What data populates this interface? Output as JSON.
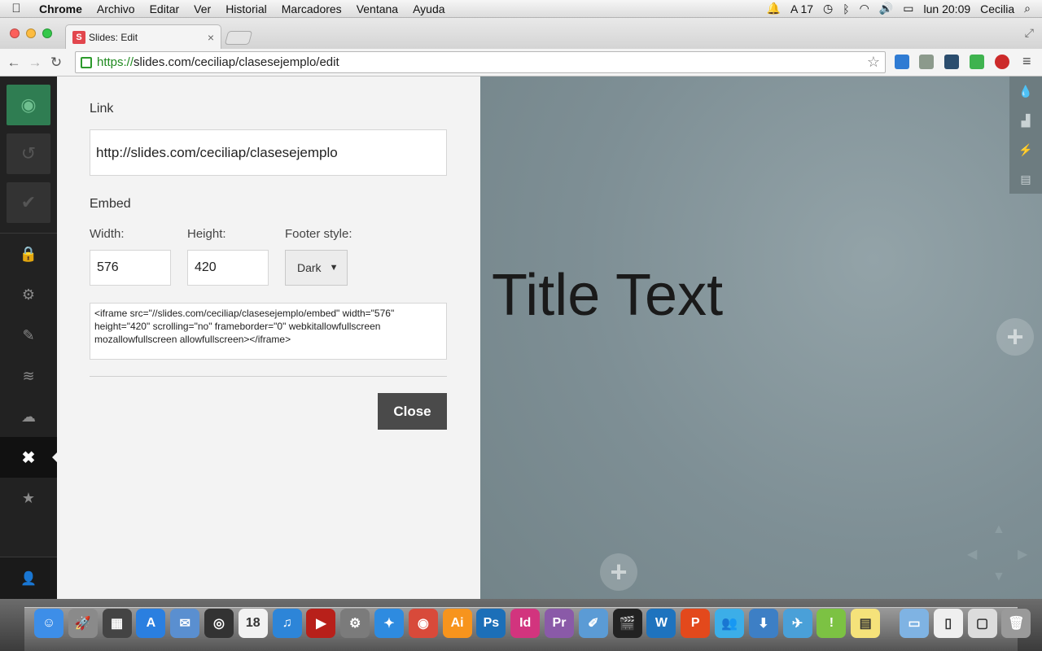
{
  "menubar": {
    "app": "Chrome",
    "items": [
      "Archivo",
      "Editar",
      "Ver",
      "Historial",
      "Marcadores",
      "Ventana",
      "Ayuda"
    ],
    "adobe_count": "17",
    "clock": "lun 20:09",
    "user": "Cecilia"
  },
  "browser": {
    "tab_title": "Slides: Edit",
    "favicon_letter": "S",
    "url_scheme": "https://",
    "url_rest": "slides.com/ceciliap/clasesejemplo/edit"
  },
  "sidebar": {
    "items": [
      {
        "name": "preview-icon",
        "glyph": "◉"
      },
      {
        "name": "undo-icon",
        "glyph": "↺"
      },
      {
        "name": "save-icon",
        "glyph": "✔"
      },
      {
        "name": "lock-icon",
        "glyph": "🔒"
      },
      {
        "name": "settings-icon",
        "glyph": "⚙"
      },
      {
        "name": "brush-icon",
        "glyph": "✎"
      },
      {
        "name": "layers-icon",
        "glyph": "≋"
      },
      {
        "name": "cloud-icon",
        "glyph": "☁"
      },
      {
        "name": "close-x-icon",
        "glyph": "✖"
      },
      {
        "name": "star-icon",
        "glyph": "★"
      }
    ],
    "user_glyph": "👤"
  },
  "panel": {
    "link_label": "Link",
    "link_value": "http://slides.com/ceciliap/clasesejemplo",
    "embed_label": "Embed",
    "width_label": "Width:",
    "width_value": "576",
    "height_label": "Height:",
    "height_value": "420",
    "footer_label": "Footer style:",
    "footer_value": "Dark",
    "embed_code": "<iframe src=\"//slides.com/ceciliap/clasesejemplo/embed\" width=\"576\" height=\"420\" scrolling=\"no\" frameborder=\"0\" webkitallowfullscreen mozallowfullscreen allowfullscreen></iframe>",
    "close_label": "Close"
  },
  "canvas": {
    "title_text": "Title Text"
  },
  "dock": {
    "icons": [
      {
        "name": "finder-icon",
        "color": "#3d8ee8",
        "glyph": "☺"
      },
      {
        "name": "launchpad-icon",
        "color": "#8a8a8a",
        "glyph": "🚀"
      },
      {
        "name": "dashboard-icon",
        "color": "#444444",
        "glyph": "▦"
      },
      {
        "name": "app-store-icon",
        "color": "#2a7fe0",
        "glyph": "A"
      },
      {
        "name": "mail-icon",
        "color": "#5a8fd0",
        "glyph": "✉"
      },
      {
        "name": "photo-booth-icon",
        "color": "#333333",
        "glyph": "◎"
      },
      {
        "name": "calendar-icon",
        "color": "#f2f2f2",
        "glyph": "18"
      },
      {
        "name": "itunes-icon",
        "color": "#2d85d8",
        "glyph": "♫"
      },
      {
        "name": "dvd-player-icon",
        "color": "#b8201a",
        "glyph": "▶"
      },
      {
        "name": "system-preferences-icon",
        "color": "#7b7b7b",
        "glyph": "⚙"
      },
      {
        "name": "safari-icon",
        "color": "#2e8be0",
        "glyph": "✦"
      },
      {
        "name": "chrome-icon",
        "color": "#d84a3a",
        "glyph": "◉"
      },
      {
        "name": "illustrator-icon",
        "color": "#f7941d",
        "glyph": "Ai"
      },
      {
        "name": "photoshop-icon",
        "color": "#1c6fb8",
        "glyph": "Ps"
      },
      {
        "name": "indesign-icon",
        "color": "#d2347e",
        "glyph": "Id"
      },
      {
        "name": "premiere-icon",
        "color": "#8a5aa8",
        "glyph": "Pr"
      },
      {
        "name": "preview-app-icon",
        "color": "#5b9bd5",
        "glyph": "✐"
      },
      {
        "name": "final-cut-icon",
        "color": "#222222",
        "glyph": "🎬"
      },
      {
        "name": "word-icon",
        "color": "#1e73be",
        "glyph": "W"
      },
      {
        "name": "powerpoint-icon",
        "color": "#e3491c",
        "glyph": "P"
      },
      {
        "name": "messenger-icon",
        "color": "#3caee8",
        "glyph": "👥"
      },
      {
        "name": "downloads-app-icon",
        "color": "#3d7fc5",
        "glyph": "⬇"
      },
      {
        "name": "network-icon",
        "color": "#4aa0d8",
        "glyph": "✈"
      },
      {
        "name": "evernote-icon",
        "color": "#7cc243",
        "glyph": "!"
      },
      {
        "name": "stickies-icon",
        "color": "#f5e27a",
        "glyph": "▤"
      },
      {
        "name": "folder-icon",
        "color": "#7fb3e3",
        "glyph": "▭"
      },
      {
        "name": "document-icon",
        "color": "#efefef",
        "glyph": "▯"
      },
      {
        "name": "window-icon",
        "color": "#dcdcdc",
        "glyph": "▢"
      },
      {
        "name": "trash-icon",
        "color": "#9a9a9a",
        "glyph": "🗑"
      }
    ]
  }
}
